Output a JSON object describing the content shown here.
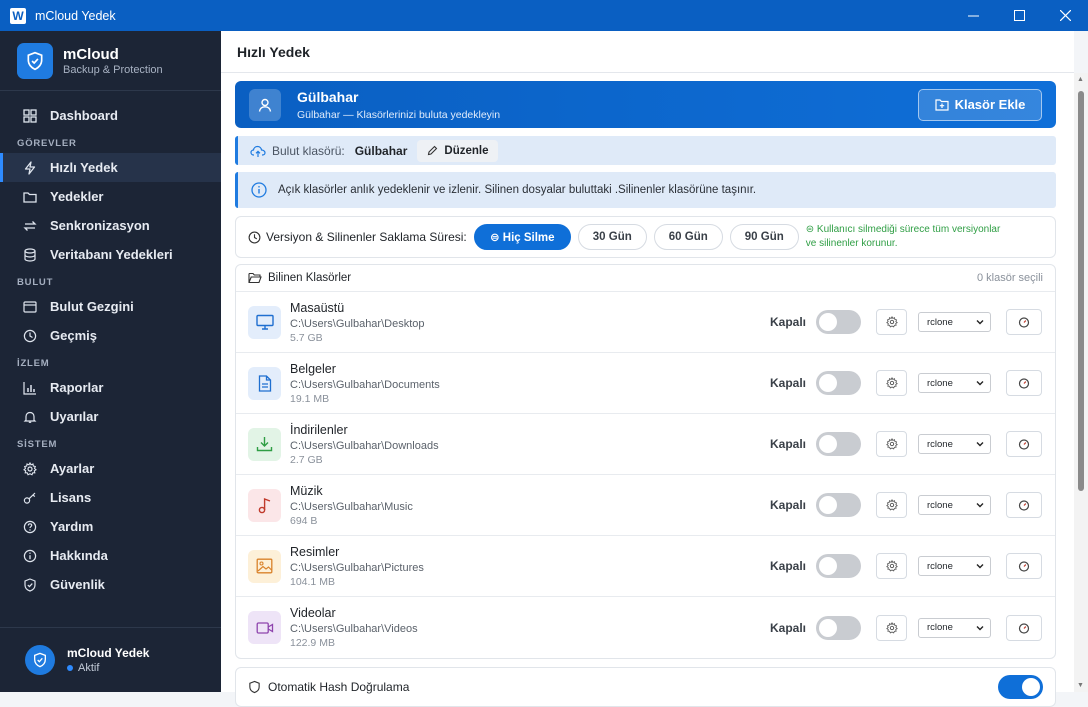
{
  "window": {
    "title": "mCloud Yedek",
    "app_letter": "W"
  },
  "sidebar": {
    "brand_name": "mCloud",
    "brand_sub": "Backup & Protection",
    "dashboard": "Dashboard",
    "section_gorevler": "GÖREVLER",
    "hizli_yedek": "Hızlı Yedek",
    "yedekler": "Yedekler",
    "senkronizasyon": "Senkronizasyon",
    "veritabani": "Veritabanı Yedekleri",
    "section_bulut": "BULUT",
    "bulut_gezgini": "Bulut Gezgini",
    "gecmis": "Geçmiş",
    "section_izlem": "İZLEM",
    "raporlar": "Raporlar",
    "uyarilar": "Uyarılar",
    "section_sistem": "SİSTEM",
    "ayarlar": "Ayarlar",
    "lisans": "Lisans",
    "yardim": "Yardım",
    "hakkinda": "Hakkında",
    "guvenlik": "Güvenlik",
    "footer_name": "mCloud Yedek",
    "footer_status": "Aktif"
  },
  "page": {
    "title": "Hızlı Yedek"
  },
  "hero": {
    "name": "Gülbahar",
    "subtitle": "Gülbahar — Klasörlerinizi buluta yedekleyin",
    "add_button": "Klasör Ekle"
  },
  "cloud": {
    "label": "Bulut klasörü:",
    "value": "Gülbahar",
    "edit_button": "Düzenle"
  },
  "info": {
    "text": "Açık klasörler anlık yedeklenir ve izlenir. Silinen dosyalar buluttaki .Silinenler klasörüne taşınır."
  },
  "retention": {
    "label": "Versiyon & Silinenler Saklama Süresi:",
    "opt_never": "⊜ Hiç Silme",
    "opt_30": "30 Gün",
    "opt_60": "60 Gün",
    "opt_90": "90 Gün",
    "note_line1": "⊜ Kullanıcı silmediği sürece tüm versiyonlar",
    "note_line2": "ve silinenler korunur."
  },
  "folders": {
    "header": "Bilinen Klasörler",
    "selected_count": "0 klasör seçili",
    "state_label": "Kapalı",
    "engine": "rclone",
    "items": [
      {
        "name": "Masaüstü",
        "path": "C:\\Users\\Gulbahar\\Desktop",
        "size": "5.7 GB"
      },
      {
        "name": "Belgeler",
        "path": "C:\\Users\\Gulbahar\\Documents",
        "size": "19.1 MB"
      },
      {
        "name": "İndirilenler",
        "path": "C:\\Users\\Gulbahar\\Downloads",
        "size": "2.7 GB"
      },
      {
        "name": "Müzik",
        "path": "C:\\Users\\Gulbahar\\Music",
        "size": "694 B"
      },
      {
        "name": "Resimler",
        "path": "C:\\Users\\Gulbahar\\Pictures",
        "size": "104.1 MB"
      },
      {
        "name": "Videolar",
        "path": "C:\\Users\\Gulbahar\\Videos",
        "size": "122.9 MB"
      }
    ]
  },
  "hash": {
    "label": "Otomatik Hash Doğrulama",
    "enabled": true
  },
  "colors": {
    "accent": "#0f6fd8",
    "sidebar_bg": "#1c2536",
    "titlebar": "#0a5fc2",
    "success": "#2f9e44"
  }
}
